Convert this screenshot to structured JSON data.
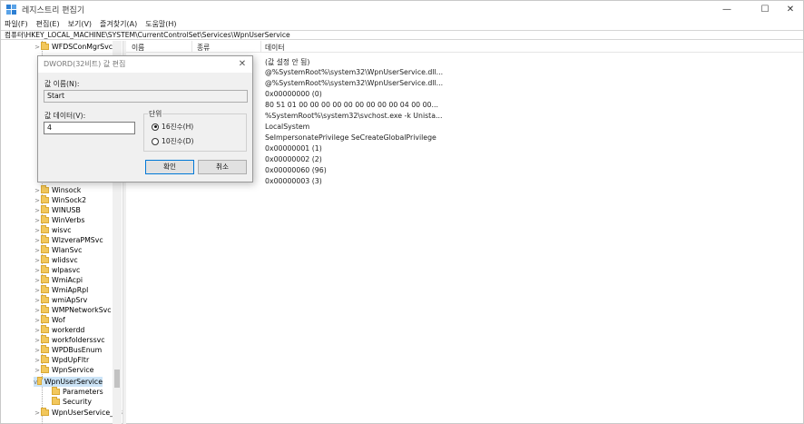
{
  "window": {
    "title": "레지스트리 편집기",
    "controls": [
      "—",
      "☐",
      "✕"
    ]
  },
  "menu": [
    "파일(F)",
    "편집(E)",
    "보기(V)",
    "즐겨찾기(A)",
    "도움말(H)"
  ],
  "address": "컴퓨터\\HKEY_LOCAL_MACHINE\\SYSTEM\\CurrentControlSet\\Services\\WpnUserService",
  "tree": {
    "top_item": "WFDSConMgrSvc",
    "items": [
      "Winsock",
      "WinSock2",
      "WINUSB",
      "WinVerbs",
      "wisvc",
      "WlzveraPMSvc",
      "WlanSvc",
      "wlidsvc",
      "wlpasvc",
      "WmiAcpi",
      "WmiApRpl",
      "wmiApSrv",
      "WMPNetworkSvc",
      "Wof",
      "workerdd",
      "workfolderssvc",
      "WPDBusEnum",
      "WpdUpFltr",
      "WpnService",
      "WpnUserService"
    ],
    "children": [
      "Parameters",
      "Security"
    ],
    "bottom_item": "WpnUserService_33..."
  },
  "list": {
    "columns": [
      "이름",
      "종류",
      "데이터"
    ],
    "data": [
      "(값 설정 안 됨)",
      "@%SystemRoot%\\system32\\WpnUserService.dll...",
      "@%SystemRoot%\\system32\\WpnUserService.dll...",
      "0x00000000 (0)",
      "80 51 01 00 00 00 00 00 00 00 00 00 04 00 00...",
      "%SystemRoot%\\system32\\svchost.exe -k Unista...",
      "LocalSystem",
      "SeImpersonatePrivilege SeCreateGlobalPrivilege",
      "0x00000001 (1)",
      "0x00000002 (2)",
      "0x00000060 (96)",
      "0x00000003 (3)"
    ]
  },
  "dialog": {
    "title": "DWORD(32비트) 값 편집",
    "close": "✕",
    "name_label": "값 이름(N):",
    "name_value": "Start",
    "data_label": "값 데이터(V):",
    "data_value": "4",
    "base_label": "단위",
    "hex_option": "16진수(H)",
    "dec_option": "10진수(D)",
    "hex_selected": true,
    "ok_label": "확인",
    "cancel_label": "취소"
  }
}
